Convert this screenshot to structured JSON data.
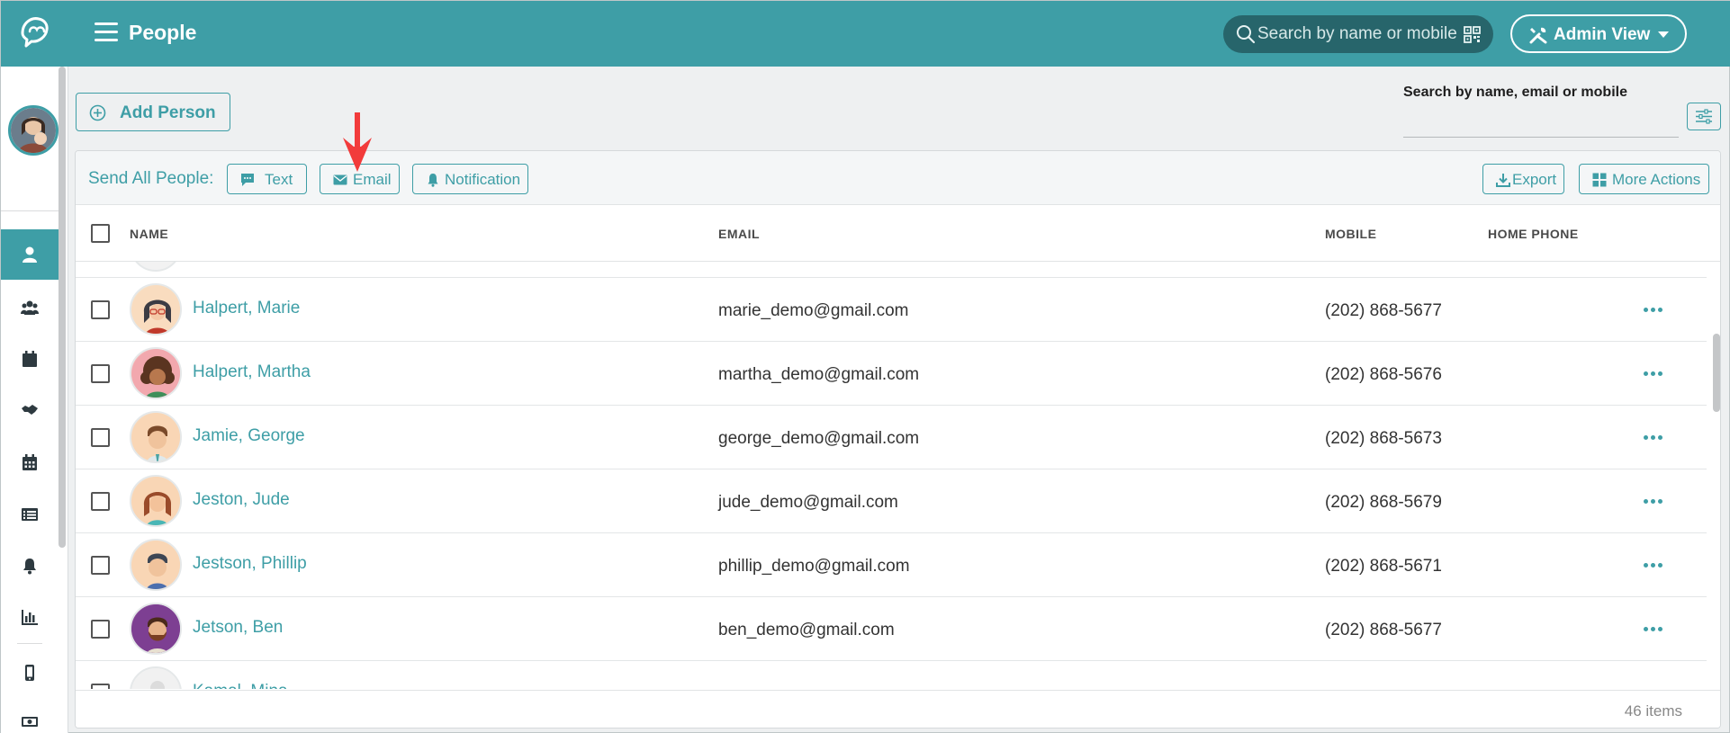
{
  "header": {
    "title": "People",
    "search_placeholder": "Search by name or mobile",
    "admin_label": "Admin View"
  },
  "content": {
    "add_person_label": "Add Person",
    "search_label": "Search by name, email or mobile",
    "search_value": ""
  },
  "toolbar": {
    "send_label": "Send All People:",
    "text_label": "Text",
    "email_label": "Email",
    "notification_label": "Notification",
    "export_label": "Export",
    "more_actions_label": "More Actions"
  },
  "table": {
    "columns": [
      "NAME",
      "EMAIL",
      "MOBILE",
      "HOME PHONE"
    ],
    "rows": [
      {
        "name": "Halpert, Marie",
        "email": "marie_demo@gmail.com",
        "mobile": "(202) 868-5677",
        "home_phone": ""
      },
      {
        "name": "Halpert, Martha",
        "email": "martha_demo@gmail.com",
        "mobile": "(202) 868-5676",
        "home_phone": ""
      },
      {
        "name": "Jamie, George",
        "email": "george_demo@gmail.com",
        "mobile": "(202) 868-5673",
        "home_phone": ""
      },
      {
        "name": "Jeston, Jude",
        "email": "jude_demo@gmail.com",
        "mobile": "(202) 868-5679",
        "home_phone": ""
      },
      {
        "name": "Jestson, Phillip",
        "email": "phillip_demo@gmail.com",
        "mobile": "(202) 868-5671",
        "home_phone": ""
      },
      {
        "name": "Jetson, Ben",
        "email": "ben_demo@gmail.com",
        "mobile": "(202) 868-5677",
        "home_phone": ""
      },
      {
        "name": "Kamal, Mina",
        "email": "",
        "mobile": "",
        "home_phone": ""
      }
    ],
    "items_count": "46 items"
  },
  "sidebar": {
    "items": [
      "dashboard-chart-icon",
      "person-icon",
      "groups-icon",
      "calendar-icon",
      "handshake-icon",
      "schedule-icon",
      "list-icon",
      "bell-icon",
      "bar-chart-icon",
      "mobile-icon",
      "money-icon"
    ],
    "active": "person-icon"
  },
  "colors": {
    "brand": "#3e9ea6",
    "search_bg": "#27656b",
    "annotation_arrow": "#f23b3b"
  }
}
